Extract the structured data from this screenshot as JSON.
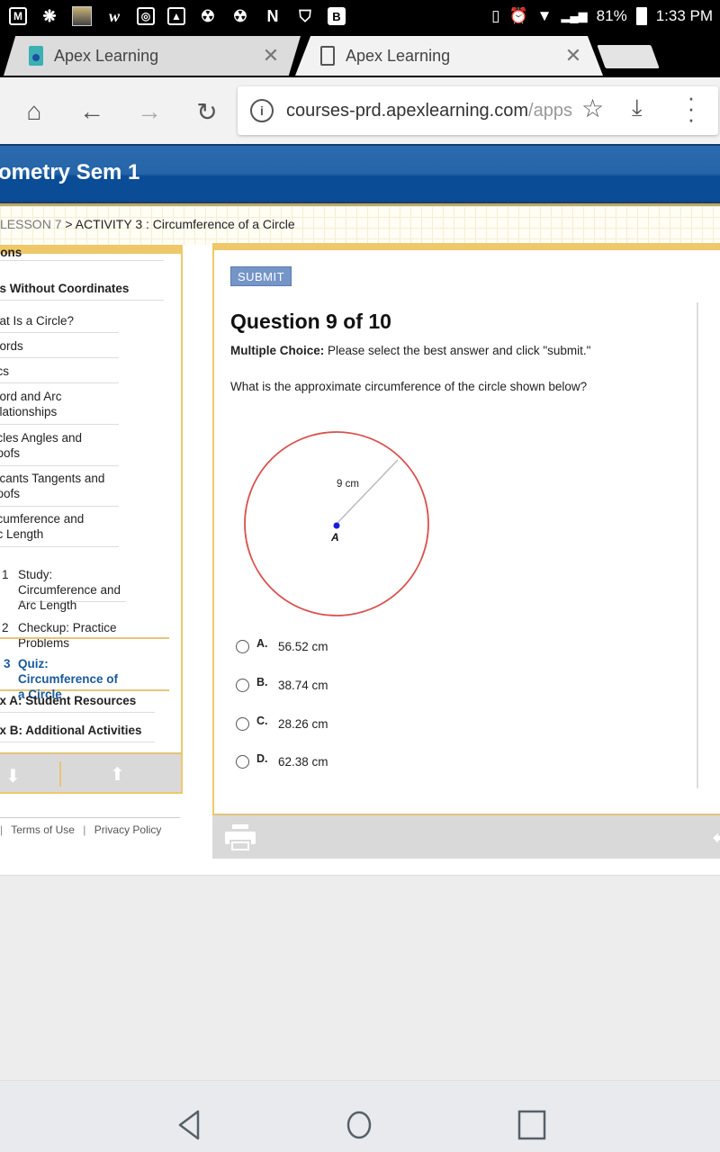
{
  "status_bar": {
    "notification_icons": [
      "gmail-icon",
      "cat-icon",
      "avatar-icon",
      "wattpad-icon",
      "instagram-icon",
      "gallery-icon",
      "android-icon",
      "android-icon",
      "netflix-icon",
      "wifi-shield-icon",
      "b-icon"
    ],
    "battery": "81%",
    "time": "1:33 PM"
  },
  "browser": {
    "tabs": [
      {
        "title": "Apex Learning",
        "active": false
      },
      {
        "title": "Apex Learning",
        "active": true
      }
    ],
    "url_host": "courses-prd.apexlearning.com",
    "url_path": "/apps"
  },
  "page": {
    "course_title": "ometry Sem 1",
    "breadcrumb": {
      "lesson": "LESSON 7",
      "separator": " > ",
      "activity": "ACTIVITY 3 : Circumference of a Circle"
    },
    "sidebar": {
      "items": [
        {
          "label": "gons",
          "style": "bold"
        },
        {
          "label": "es Without Coordinates",
          "style": "bold"
        },
        {
          "label": "hat Is a Circle?"
        },
        {
          "label": "hords"
        },
        {
          "label": "rcs"
        },
        {
          "label": "hord and Arc\nelationships"
        },
        {
          "label": "rcles Angles and\nroofs"
        },
        {
          "label": "ecants Tangents and\nroofs"
        },
        {
          "label": "rcumference and\nrc Length"
        },
        {
          "num": "1",
          "label": "Study:\nCircumference and\nArc Length"
        },
        {
          "num": "2",
          "label": "Checkup: Practice\nProblems"
        },
        {
          "num": "3",
          "label": "Quiz:\nCircumference of\na Circle",
          "style": "active"
        },
        {
          "label": "lix A: Student Resources",
          "style": "bold"
        },
        {
          "label": "lix B: Additional Activities",
          "style": "bold"
        }
      ]
    },
    "footer_links": [
      "Terms of Use",
      "Privacy Policy"
    ],
    "submit_label": "SUBMIT",
    "question": {
      "title": "Question 9 of 10",
      "instruction_label": "Multiple Choice:",
      "instruction_text": " Please select the best answer and click \"submit.\"",
      "prompt": "What is the approximate circumference of the circle shown below?",
      "figure": {
        "radius_label": "9 cm",
        "center_label": "A",
        "circle_color": "#d9534f",
        "center_color": "#1a1adf"
      },
      "choices": [
        {
          "letter": "A.",
          "text": "56.52 cm",
          "selected": false
        },
        {
          "letter": "B.",
          "text": "38.74 cm",
          "selected": false
        },
        {
          "letter": "C.",
          "text": "28.26 cm",
          "selected": false
        },
        {
          "letter": "D.",
          "text": "62.38 cm",
          "selected": false
        }
      ]
    }
  },
  "colors": {
    "header_blue": "#0a4c96",
    "accent_gold": "#efc86a",
    "active_link": "#1a5a9c",
    "submit_bg": "#7595c8"
  }
}
